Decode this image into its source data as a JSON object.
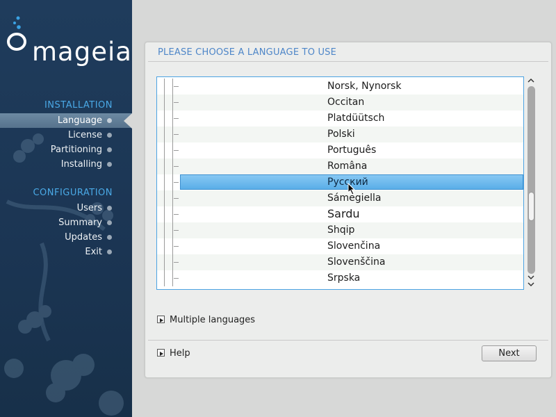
{
  "sidebar": {
    "logo_text": "mageia",
    "sections": [
      {
        "title": "INSTALLATION",
        "items": [
          {
            "label": "Language",
            "active": true
          },
          {
            "label": "License",
            "active": false
          },
          {
            "label": "Partitioning",
            "active": false
          },
          {
            "label": "Installing",
            "active": false
          }
        ]
      },
      {
        "title": "CONFIGURATION",
        "items": [
          {
            "label": "Users",
            "active": false
          },
          {
            "label": "Summary",
            "active": false
          },
          {
            "label": "Updates",
            "active": false
          },
          {
            "label": "Exit",
            "active": false
          }
        ]
      }
    ]
  },
  "panel": {
    "title": "PLEASE CHOOSE A LANGUAGE TO USE"
  },
  "language_list": {
    "items": [
      {
        "label": "Norsk, Nynorsk",
        "selected": false
      },
      {
        "label": "Occitan",
        "selected": false
      },
      {
        "label": "Platdüütsch",
        "selected": false
      },
      {
        "label": "Polski",
        "selected": false
      },
      {
        "label": "Português",
        "selected": false
      },
      {
        "label": "Româna",
        "selected": false
      },
      {
        "label": "Русский",
        "selected": true
      },
      {
        "label": "Sámegiella",
        "selected": false
      },
      {
        "label": "Sardu",
        "selected": false
      },
      {
        "label": "Shqip",
        "selected": false
      },
      {
        "label": "Slovenčina",
        "selected": false
      },
      {
        "label": "Slovenščina",
        "selected": false
      },
      {
        "label": "Srpska",
        "selected": false
      }
    ]
  },
  "expanders": {
    "multiple_languages": "Multiple languages",
    "help": "Help"
  },
  "buttons": {
    "next": "Next"
  },
  "colors": {
    "sidebar_bg": "#1f3c5c",
    "accent": "#4aa9e6",
    "selection": "#5aaee8",
    "panel_title": "#4e86c8"
  },
  "icons": {
    "scroll_up": "chevron-up-icon",
    "scroll_down": "chevron-down-icon",
    "expander": "triangle-right-icon"
  }
}
